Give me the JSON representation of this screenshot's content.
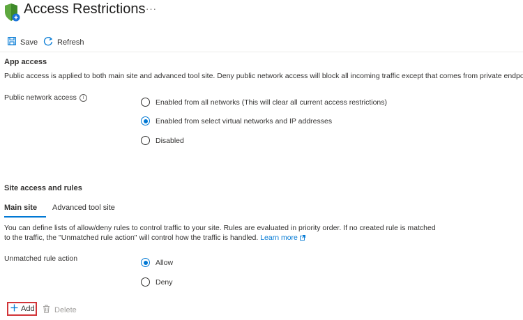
{
  "header": {
    "title": "Access Restrictions",
    "more_label": "···"
  },
  "toolbar": {
    "save_label": "Save",
    "refresh_label": "Refresh"
  },
  "app_access": {
    "heading": "App access",
    "description": "Public access is applied to both main site and advanced tool site. Deny public network access will block all incoming traffic except that comes from private endpoints.",
    "public_network_label": "Public network access",
    "info_icon": "i",
    "options": [
      {
        "label": "Enabled from all networks (This will clear all current access restrictions)",
        "checked": false
      },
      {
        "label": "Enabled from select virtual networks and IP addresses",
        "checked": true
      },
      {
        "label": "Disabled",
        "checked": false
      }
    ]
  },
  "site_access": {
    "heading": "Site access and rules",
    "tabs": [
      {
        "label": "Main site",
        "active": true
      },
      {
        "label": "Advanced tool site",
        "active": false
      }
    ],
    "description_line1": "You can define lists of allow/deny rules to control traffic to your site. Rules are evaluated in priority order. If no created rule is matched",
    "description_line2": "to the traffic, the \"Unmatched rule action\" will control how the traffic is handled.",
    "learn_more": "Learn more",
    "unmatched_label": "Unmatched rule action",
    "unmatched_options": [
      {
        "label": "Allow",
        "checked": true
      },
      {
        "label": "Deny",
        "checked": false
      }
    ]
  },
  "actions": {
    "add_label": "Add",
    "delete_label": "Delete"
  },
  "colors": {
    "accent": "#0078d4",
    "shield_green": "#5ea83f",
    "highlight_red": "#d13438"
  }
}
